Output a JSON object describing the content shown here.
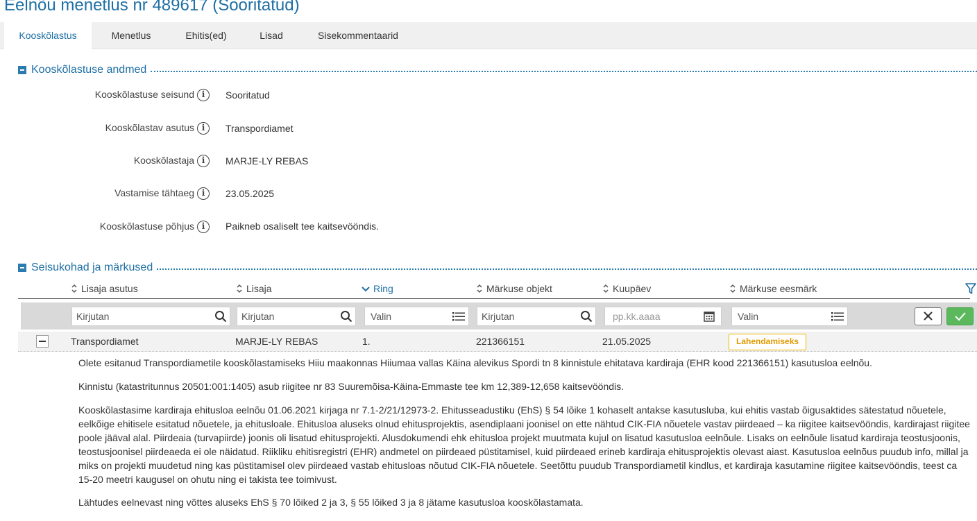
{
  "page": {
    "title": "Eelnõu menetlus nr 489617 (Sooritatud)"
  },
  "tabs": [
    {
      "label": "Kooskõlastus",
      "active": true
    },
    {
      "label": "Menetlus"
    },
    {
      "label": "Ehitis(ed)"
    },
    {
      "label": "Lisad"
    },
    {
      "label": "Sisekommentaarid"
    }
  ],
  "details": {
    "title": "Kooskõlastuse andmed",
    "fields": [
      {
        "label": "Kooskõlastuse seisund",
        "value": "Sooritatud"
      },
      {
        "label": "Kooskõlastav asutus",
        "value": "Transpordiamet"
      },
      {
        "label": "Kooskõlastaja",
        "value": "MARJE-LY REBAS"
      },
      {
        "label": "Vastamise tähtaeg",
        "value": "23.05.2025"
      },
      {
        "label": "Kooskõlastuse põhjus",
        "value": "Paikneb osaliselt tee kaitsevööndis."
      }
    ]
  },
  "remarks": {
    "title": "Seisukohad ja märkused",
    "columns": [
      "Lisaja asutus",
      "Lisaja",
      "Ring",
      "Märkuse objekt",
      "Kuupäev",
      "Märkuse eesmärk"
    ],
    "sorted_column": "Ring",
    "filters": {
      "asutus": "Kirjutan",
      "lisaja": "Kirjutan",
      "ring": "Valin",
      "objekt": "Kirjutan",
      "kuupaev_placeholder": "pp.kk.aaaa",
      "eesmark": "Valin"
    },
    "row": {
      "asutus": "Transpordiamet",
      "lisaja": "MARJE-LY REBAS",
      "ring": "1.",
      "objekt": "221366151",
      "kuupaev": "21.05.2025",
      "eesmark": "Lahendamiseks"
    },
    "comment": {
      "p1": "Olete esitanud Transpordiametile kooskõlastamiseks Hiiu maakonnas Hiiumaa vallas Käina alevikus Spordi tn 8 kinnistule ehitatava kardiraja (EHR kood 221366151) kasutusloa eelnõu.",
      "p2": "Kinnistu (katastritunnus 20501:001:1405) asub riigitee nr 83 Suuremõisa-Käina-Emmaste tee km 12,389-12,658 kaitsevööndis.",
      "p3": "Kooskõlastasime kardiraja ehitusloa eelnõu 01.06.2021 kirjaga nr 7.1-2/21/12973-2. Ehitusseadustiku (EhS) § 54 lõike 1 kohaselt antakse kasutusluba, kui ehitis vastab õigusaktides sätestatud nõuetele, eelkõige ehitisele esitatud nõuetele, ja ehitusloale. Ehitusloa aluseks olnud ehitusprojektis, asendiplaani joonisel on ette nähtud CIK-FIA nõuetele vastav piirdeaed – ka riigitee kaitsevööndis, kardirajast riigitee poole jääval alal. Piirdeaia (turvapiirde) joonis oli lisatud ehitusprojekti. Alusdokumendi ehk ehitusloa projekt muutmata kujul on lisatud kasutusloa eelnõule. Lisaks on eelnõule lisatud kardiraja teostusjoonis, teostusjoonisel piirdeaeda ei ole näidatud. Riikliku ehitisregistri (EHR) andmetel on piirdeaed püstitamisel, kuid piirdeaed erineb kardiraja ehitusprojektis olevast aiast. Kasutusloa eelnõus puudub info, millal ja miks on projekti muudetud ning kas püstitamisel olev piirdeaed vastab ehitusloas nõutud CIK-FIA nõuetele. Seetõttu puudub Transpordiametil kindlus, et kardiraja kasutamine riigitee kaitsevööndis, teest ca 15-20 meetri kaugusel on ohutu ning ei takista tee toimivust.",
      "p4": "Lähtudes eelnevast ning võttes aluseks EhS § 70 lõiked 2 ja 3, § 55 lõiked 3 ja 8 jätame kasutusloa kooskõlastamata."
    }
  },
  "colors": {
    "accent": "#1d6fa5",
    "badge": "#f0b400",
    "confirm": "#5cb85c"
  }
}
